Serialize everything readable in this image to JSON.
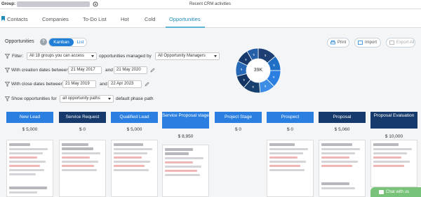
{
  "topbar": {
    "group_label": "Group:",
    "recent_label": "Recent CRM activities"
  },
  "nav": {
    "tabs": [
      {
        "label": "Contacts"
      },
      {
        "label": "Companies"
      },
      {
        "label": "To-Do List"
      },
      {
        "label": "Hot"
      },
      {
        "label": "Cold"
      },
      {
        "label": "Opportunities"
      }
    ]
  },
  "header": {
    "title": "Opportunities",
    "help": "?",
    "view_kanban": "Kanban",
    "view_list": "List",
    "print": "Print",
    "import": "Import",
    "export_all": "Export All"
  },
  "filters": {
    "filter_label": "Filter:",
    "groups_value": "All 18 groups you can access",
    "managed_by_label": "opportunities managed by",
    "managers_value": "All Opportunity Managers",
    "creation_label": "With creation dates between",
    "creation_start": "21 May 2017",
    "and1": "and",
    "creation_end": "21 May 2020",
    "close_label": "With close dates between",
    "close_start": "21 May 2019",
    "and2": "and",
    "close_end": "22 Apr 2023",
    "show_label": "Show opportunities for",
    "paths_value": "all opportunity paths",
    "default_path_label": "default phase path"
  },
  "donut": {
    "center_label": "39K",
    "segment_labels": [
      "$",
      "$",
      "$",
      "$",
      "$",
      "$",
      "$",
      "$",
      "$"
    ],
    "colors": [
      "#1d3f73",
      "#1f6fc4",
      "#2a7fe0",
      "#3d8de6",
      "#18406f",
      "#153564",
      "#2669b8",
      "#163a6b",
      "#245fa8"
    ]
  },
  "columns": [
    {
      "name": "New Lead",
      "value": "$ 5,000",
      "color": "#2a7fe0"
    },
    {
      "name": "Service Request",
      "value": "$ 0",
      "color": "#163a6b"
    },
    {
      "name": "Qualified Lead",
      "value": "$ 5,000",
      "color": "#2a7fe0"
    },
    {
      "name": "Service Proposal stage",
      "value": "$ 8,950",
      "color": "#2a7fe0"
    },
    {
      "name": "Project Stage",
      "value": "$ 0",
      "color": "#2a7fe0"
    },
    {
      "name": "Prospect",
      "value": "$ 0",
      "color": "#2a7fe0"
    },
    {
      "name": "Proposal",
      "value": "$ 5,060",
      "color": "#163a6b"
    },
    {
      "name": "Proposal Evaluation",
      "value": "$ 10,000",
      "color": "#163a6b"
    }
  ],
  "chat": {
    "label": "Chat with us"
  }
}
